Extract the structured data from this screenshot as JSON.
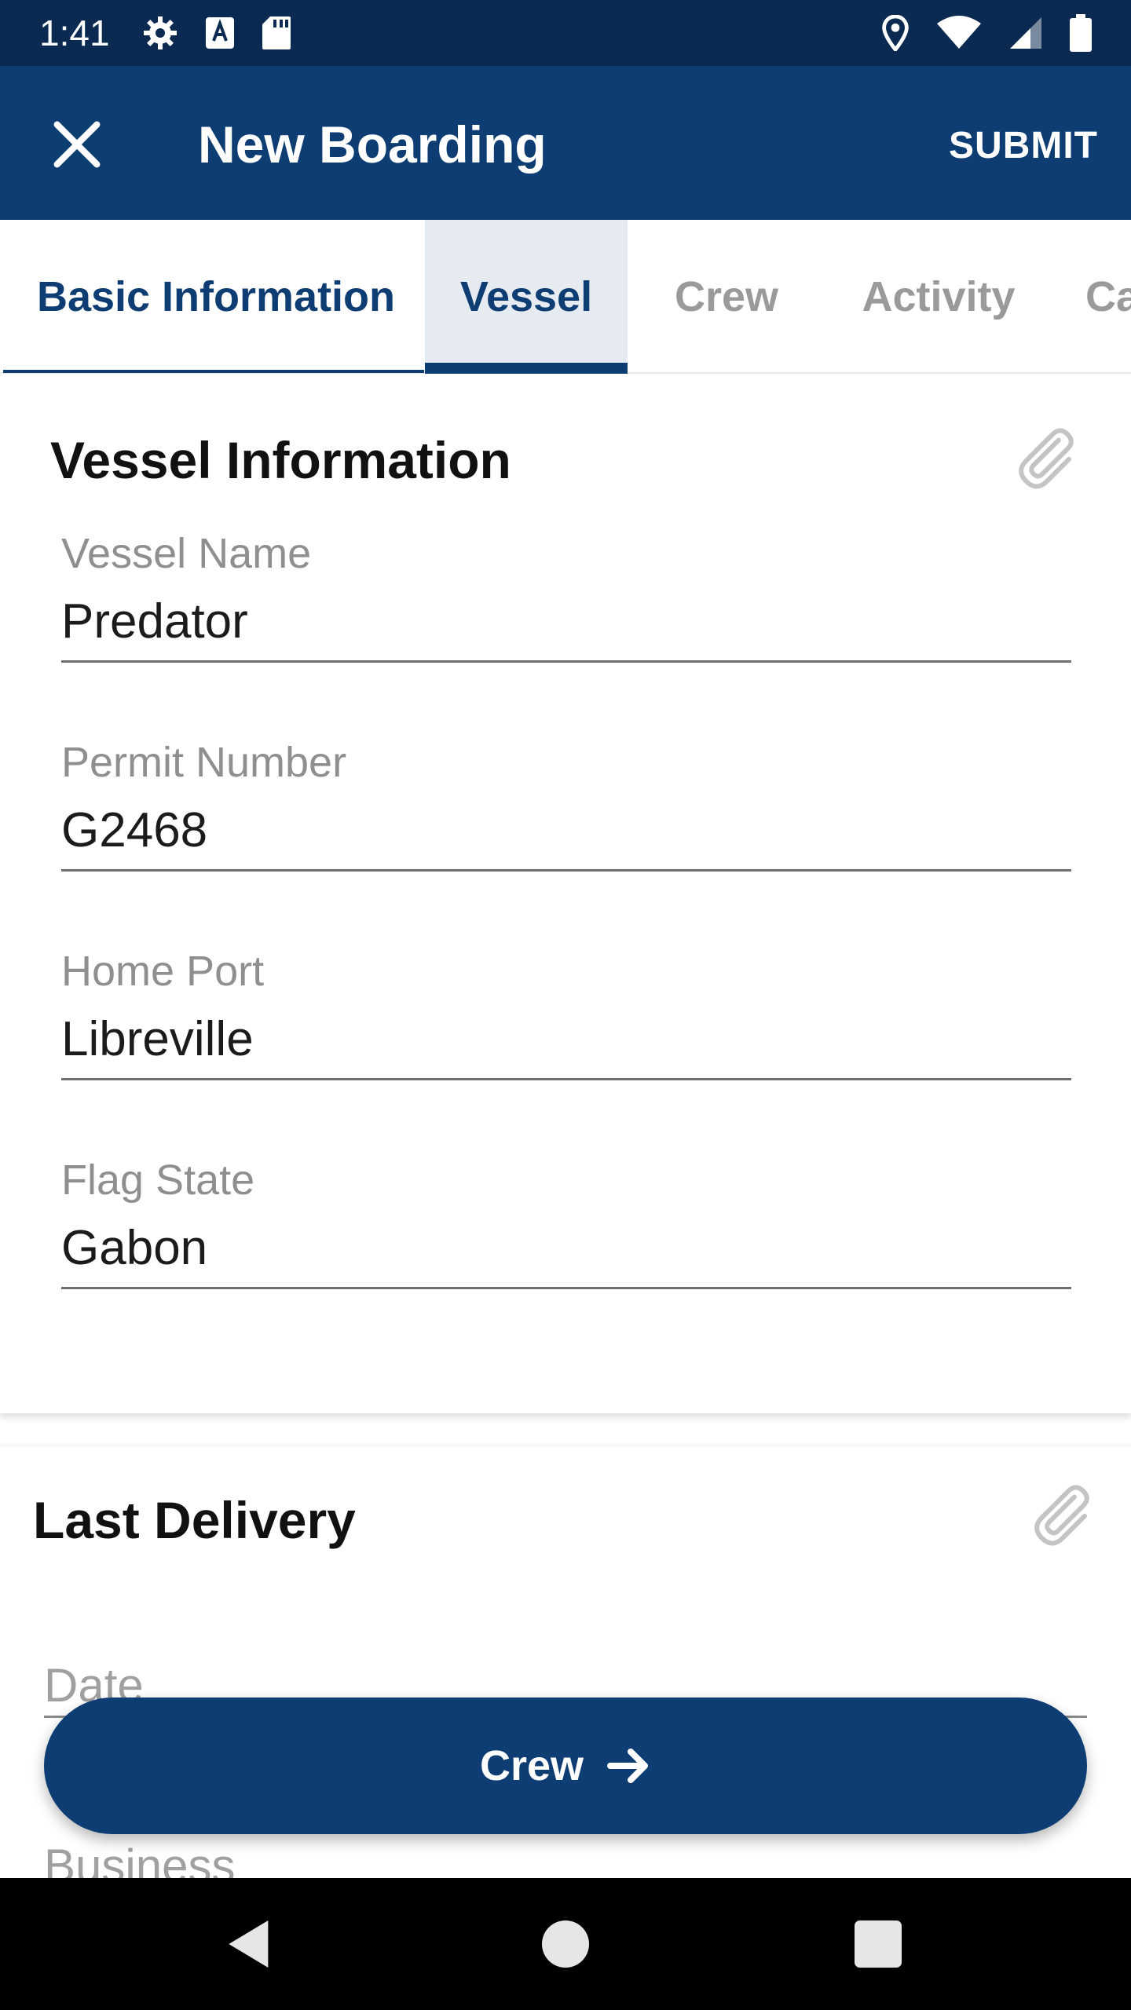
{
  "status_bar": {
    "time": "1:41",
    "icons_left": [
      "settings-icon",
      "text-a-icon",
      "sd-card-icon"
    ],
    "icons_right": [
      "location-icon",
      "wifi-icon",
      "signal-icon",
      "battery-icon"
    ]
  },
  "app_bar": {
    "title": "New Boarding",
    "submit_label": "SUBMIT"
  },
  "tabs": [
    {
      "label": "Basic Information"
    },
    {
      "label": "Vessel"
    },
    {
      "label": "Crew"
    },
    {
      "label": "Activity"
    },
    {
      "label": "Ca"
    }
  ],
  "vessel_section": {
    "title": "Vessel Information",
    "fields": [
      {
        "label": "Vessel Name",
        "value": "Predator"
      },
      {
        "label": "Permit Number",
        "value": "G2468"
      },
      {
        "label": "Home Port",
        "value": "Libreville"
      },
      {
        "label": "Flag State",
        "value": "Gabon"
      }
    ]
  },
  "delivery_section": {
    "title": "Last Delivery",
    "fields": [
      {
        "label": "Date"
      },
      {
        "label": "Business"
      }
    ]
  },
  "next_button": {
    "label": "Crew",
    "icon": "arrow-right-icon"
  },
  "nav_bar": {
    "buttons": [
      "back-icon",
      "home-icon",
      "recents-icon"
    ]
  },
  "colors": {
    "primary": "#0d3d72",
    "status_bar": "#0b2a52",
    "active_tab_bg": "#e6ebf1",
    "inactive_tab_text": "#9a9a9a",
    "label_text": "#8f8f8f"
  }
}
